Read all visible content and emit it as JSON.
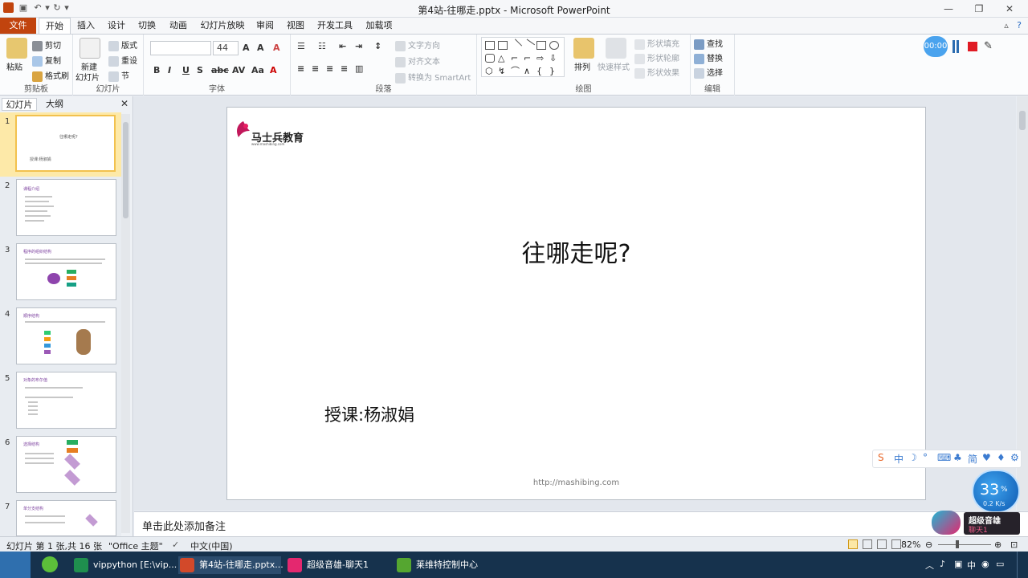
{
  "window": {
    "title": "第4站-往哪走.pptx - Microsoft PowerPoint",
    "min_icon": "minimize-icon",
    "max_icon": "maximize-icon",
    "close_icon": "close-icon"
  },
  "tabs": [
    "文件",
    "开始",
    "插入",
    "设计",
    "切换",
    "动画",
    "幻灯片放映",
    "审阅",
    "视图",
    "开发工具",
    "加载项"
  ],
  "active_tab": "开始",
  "ribbon": {
    "clipboard": {
      "label": "剪贴板",
      "paste": "粘贴",
      "cut": "剪切",
      "copy": "复制",
      "format_painter": "格式刷"
    },
    "slides": {
      "label": "幻灯片",
      "new_slide": "新建",
      "new_slide2": "幻灯片",
      "layout": "版式",
      "reset": "重设",
      "section": "节"
    },
    "font": {
      "label": "字体",
      "size": "44"
    },
    "paragraph": {
      "label": "段落",
      "text_direction": "文字方向",
      "align_text": "对齐文本",
      "smartart": "转换为 SmartArt"
    },
    "drawing": {
      "label": "绘图",
      "arrange": "排列",
      "quick_styles": "快速样式",
      "shape_fill": "形状填充",
      "shape_outline": "形状轮廓",
      "shape_effects": "形状效果"
    },
    "editing": {
      "label": "编辑",
      "find": "查找",
      "replace": "替换",
      "select": "选择"
    }
  },
  "left_pane": {
    "tab_slides": "幻灯片",
    "tab_outline": "大纲",
    "thumbs": [
      {
        "num": "1",
        "title": "往哪走呢?",
        "sub": "授课:杨淑娟"
      },
      {
        "num": "2",
        "title": "课程介绍"
      },
      {
        "num": "3",
        "title": "程序的组织结构"
      },
      {
        "num": "4",
        "title": "顺序结构"
      },
      {
        "num": "5",
        "title": "对象的布尔值"
      },
      {
        "num": "6",
        "title": "选择结构"
      },
      {
        "num": "7",
        "title": "单分支结构"
      }
    ]
  },
  "slide": {
    "logo": "马士兵教育",
    "logo_sub": "www.mashibing.com",
    "title": "往哪走呢?",
    "subtitle": "授课:杨淑娟",
    "url": "http://mashibing.com"
  },
  "notes_placeholder": "单击此处添加备注",
  "statusbar": {
    "slide_info": "幻灯片 第 1 张,共 16 张",
    "theme": "\"Office 主题\"",
    "language": "中文(中国)",
    "zoom": "82%"
  },
  "taskbar": {
    "items": [
      "vippython [E:\\vip...",
      "第4站-往哪走.pptx...",
      "超级音雄-聊天1",
      "莱维特控制中心"
    ],
    "tray_ime": "中"
  },
  "overlays": {
    "recorder_time": "00:00",
    "ime_label": "中",
    "ime_simplified": "简",
    "speed_pct": "33",
    "speed_unit": "%",
    "speed_rate": "0.2 K/s",
    "chat_app": "超级音雄",
    "chat_sub": "聊天1"
  },
  "colors": {
    "file_tab": "#c1440e",
    "selected_thumb": "#f2c14e",
    "taskbar": "#16324d"
  }
}
